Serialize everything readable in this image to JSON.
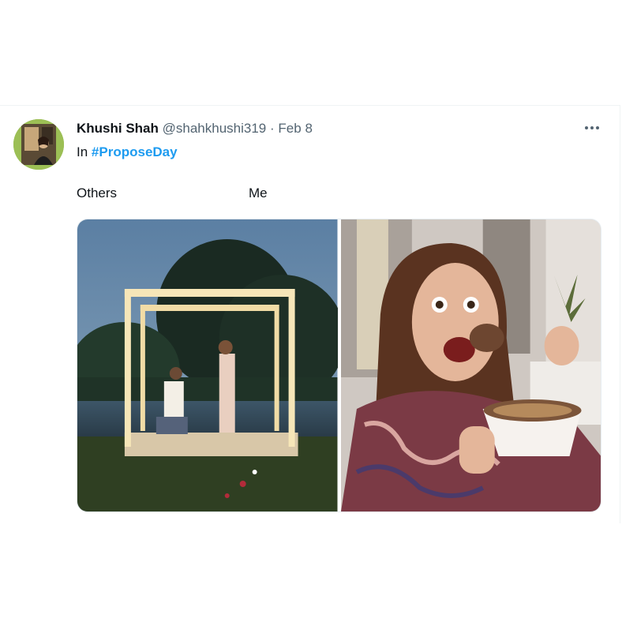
{
  "tweet": {
    "display_name": "Khushi Shah",
    "handle": "@shahkhushi319",
    "separator": "·",
    "timestamp": "Feb 8",
    "context_prefix": "In",
    "hashtag": "#ProposeDay",
    "caption_left": "Others",
    "caption_right": "Me",
    "more_icon": "more-horizontal-icon"
  },
  "colors": {
    "hashtag": "#1d9bf0",
    "secondary_text": "#536471",
    "primary_text": "#0f1419",
    "divider": "#eff3f4"
  }
}
